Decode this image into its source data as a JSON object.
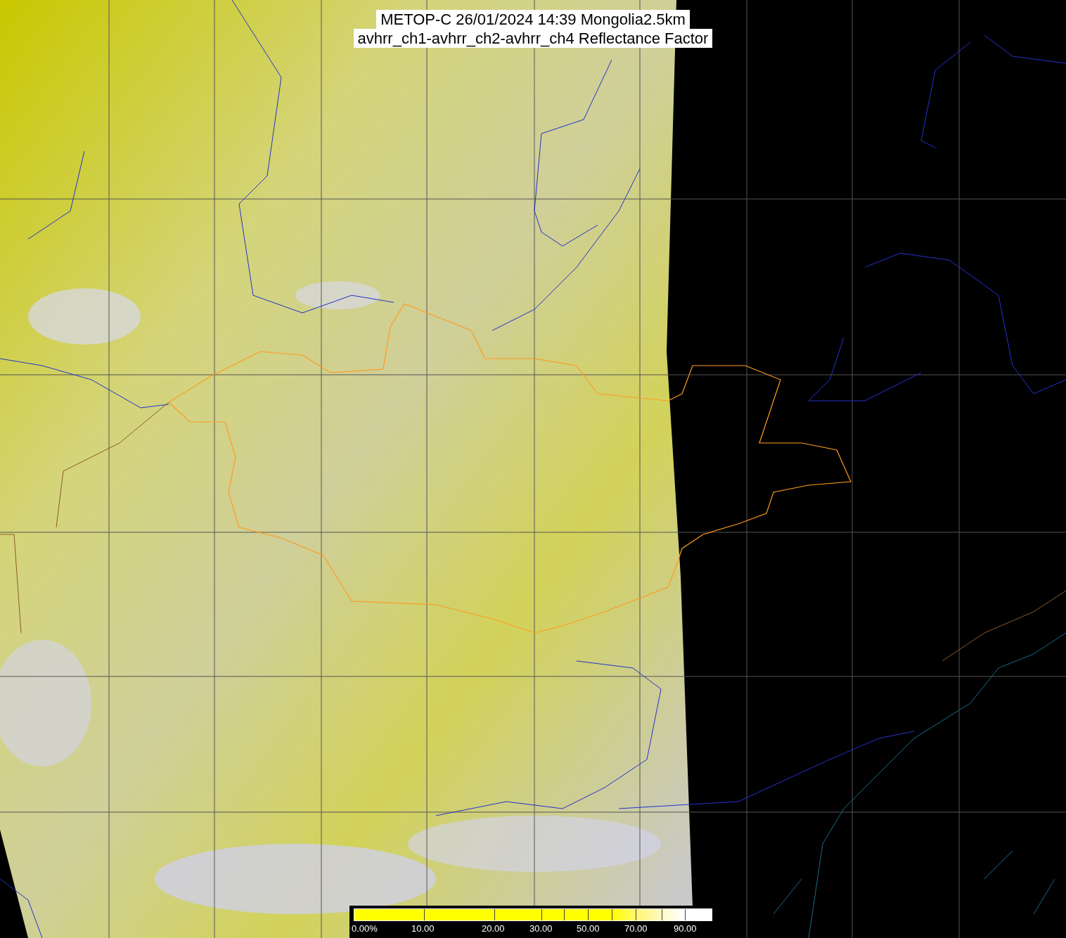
{
  "title": {
    "lines": [
      "METOP-C 26/01/2024 14:39 Mongolia2.5km",
      "avhrr_ch1-avhrr_ch2-avhrr_ch4 Reflectance Factor"
    ]
  },
  "legend": {
    "labels": [
      "0.00%",
      "10.00",
      "20.00",
      "30.00",
      "50.00",
      "70.00",
      "90.00"
    ]
  }
}
